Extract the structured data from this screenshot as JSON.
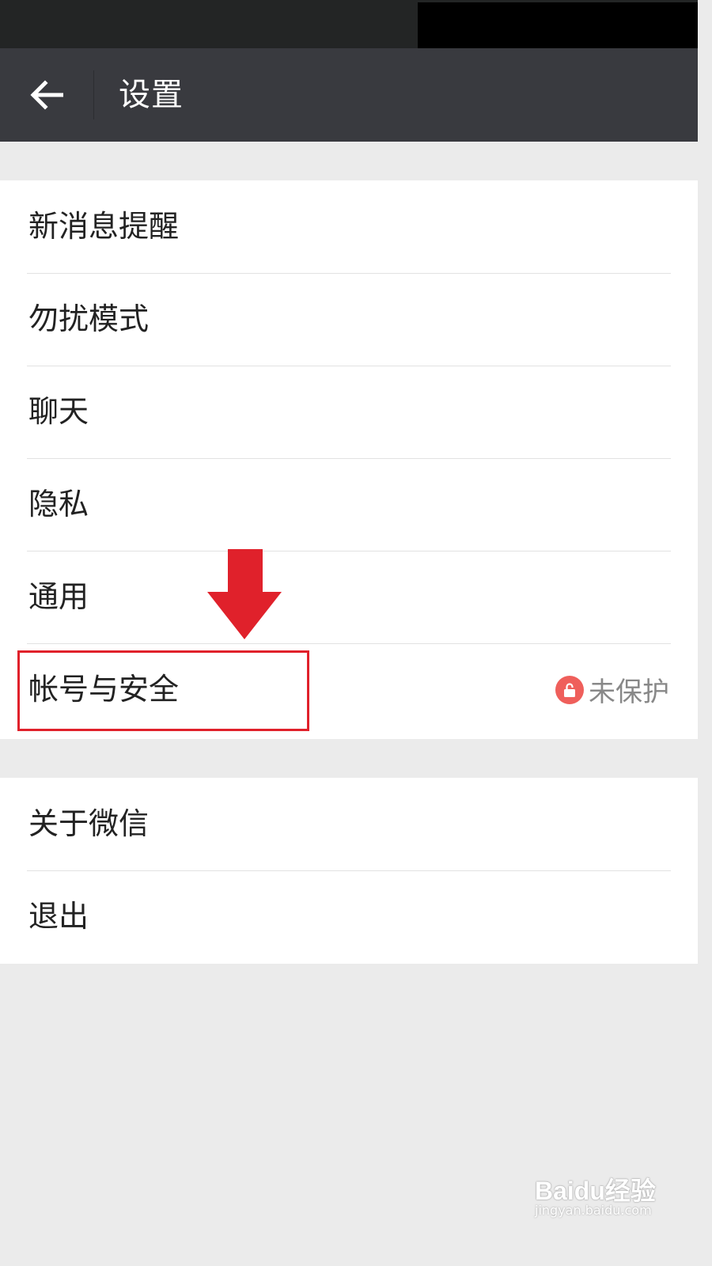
{
  "header": {
    "title": "设置",
    "back_icon": "back-arrow-icon"
  },
  "settings": {
    "group1": [
      {
        "label": "新消息提醒"
      },
      {
        "label": "勿扰模式"
      },
      {
        "label": "聊天"
      },
      {
        "label": "隐私"
      },
      {
        "label": "通用"
      },
      {
        "label": "帐号与安全",
        "status": "未保护",
        "status_icon": "unlock-icon"
      }
    ],
    "group2": [
      {
        "label": "关于微信"
      },
      {
        "label": "退出"
      }
    ]
  },
  "annotation": {
    "arrow_color": "#e0212b",
    "box_color": "#e0212b"
  },
  "watermark": {
    "logo": "Baidu经验",
    "url": "jingyan.baidu.com"
  },
  "colors": {
    "title_bar": "#393a3f",
    "status_bar": "#232525",
    "background": "#ebebeb",
    "lock_badge": "#ef5f5b"
  }
}
